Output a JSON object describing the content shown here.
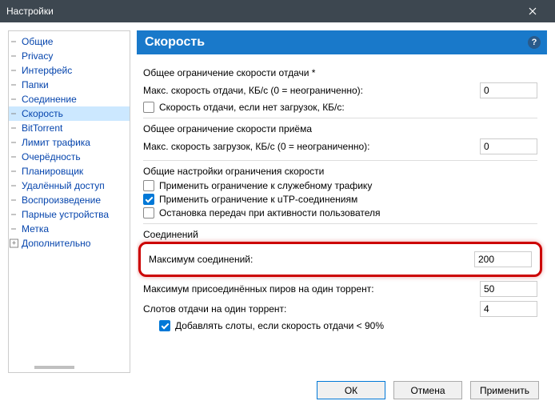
{
  "window": {
    "title": "Настройки"
  },
  "nav": {
    "items": [
      "Общие",
      "Privacy",
      "Интерфейс",
      "Папки",
      "Соединение",
      "Скорость",
      "BitTorrent",
      "Лимит трафика",
      "Очерёдность",
      "Планировщик",
      "Удалённый доступ",
      "Воспроизведение",
      "Парные устройства",
      "Метка",
      "Дополнительно"
    ]
  },
  "section": {
    "title": "Скорость"
  },
  "upload": {
    "heading": "Общее ограничение скорости отдачи *",
    "rate_label": "Макс. скорость отдачи, КБ/с (0 = неограниченно):",
    "rate_value": "0",
    "alt_label": "Скорость отдачи, если нет загрузок, КБ/с:"
  },
  "download": {
    "heading": "Общее ограничение скорости приёма",
    "rate_label": "Макс. скорость загрузок, КБ/с (0 = неограниченно):",
    "rate_value": "0"
  },
  "ratesec": {
    "heading": "Общие настройки ограничения скорости",
    "cb_overhead": "Применить ограничение к служебному трафику",
    "cb_utp": "Применить ограничение к uTP-соединениям",
    "cb_pause": "Остановка передач при активности пользователя"
  },
  "conn": {
    "heading": "Соединений",
    "max_conn_label": "Максимум соединений:",
    "max_conn_value": "200",
    "max_peers_label": "Максимум присоединённых пиров на один торрент:",
    "max_peers_value": "50",
    "slots_label": "Слотов отдачи на один торрент:",
    "slots_value": "4",
    "cb_addslots": "Добавлять слоты, если скорость отдачи < 90%"
  },
  "buttons": {
    "ok": "ОК",
    "cancel": "Отмена",
    "apply": "Применить"
  }
}
